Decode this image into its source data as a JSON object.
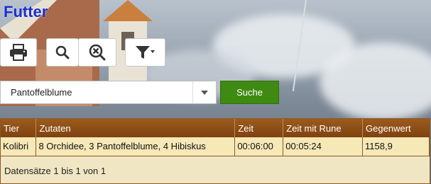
{
  "page": {
    "title": "Futter"
  },
  "toolbar": {
    "print_icon": "print-icon",
    "search_icon": "search-icon",
    "clear_search_icon": "zoom-cancel-icon",
    "filter_icon": "filter-dropdown-icon"
  },
  "search": {
    "selected_value": "Pantoffelblume",
    "button_label": "Suche"
  },
  "table": {
    "columns": [
      "Tier",
      "Zutaten",
      "Zeit",
      "Zeit mit Rune",
      "Gegenwert"
    ],
    "rows": [
      [
        "Kolibri",
        "8 Orchidee, 3 Pantoffelblume, 4 Hibiskus",
        "00:06:00",
        "00:05:24",
        "1158,9"
      ]
    ],
    "footer": "Datensätze 1 bis 1 von 1"
  },
  "colors": {
    "title": "#1a2fd0",
    "header": "#8a4b15",
    "row": "#f7e8b8",
    "button_green": "#3f8a12"
  }
}
